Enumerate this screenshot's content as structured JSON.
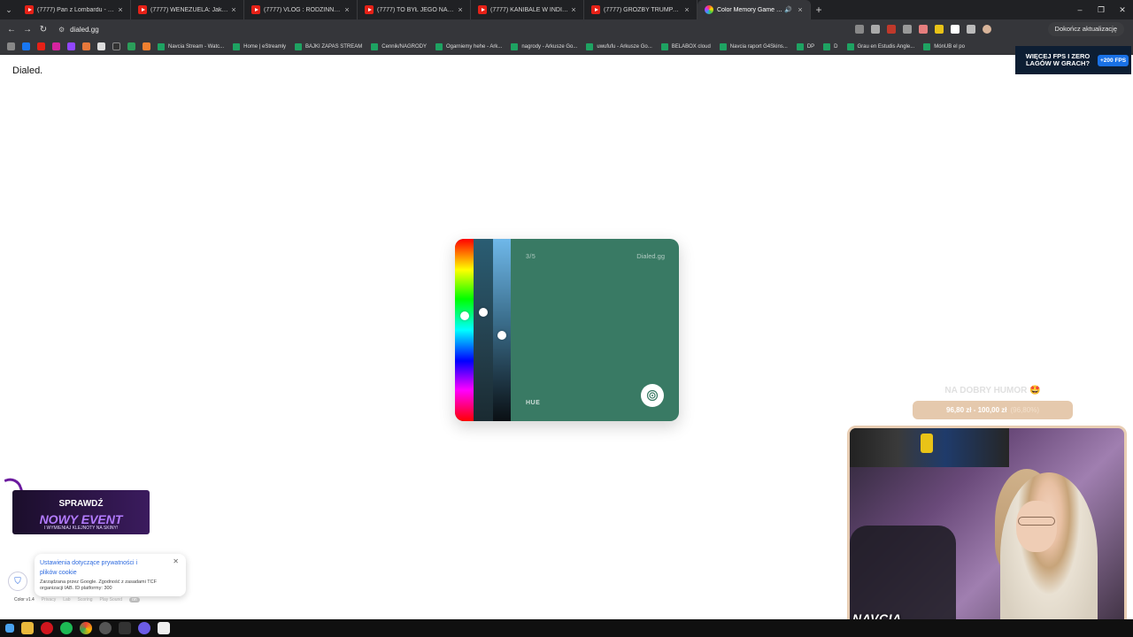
{
  "browser": {
    "tabs": [
      {
        "label": "(7777) Pan z Lombardu - YouTube",
        "type": "youtube"
      },
      {
        "label": "(7777) WENEZUELA: Jak bardzo je",
        "type": "youtube"
      },
      {
        "label": "(7777) VLOG : RODZINNY DZIEŃ",
        "type": "youtube"
      },
      {
        "label": "(7777) TO BYŁ JEGO NAJGORSZY",
        "type": "youtube"
      },
      {
        "label": "(7777) KANIBALE W INDIACH - D",
        "type": "youtube"
      },
      {
        "label": "(7777) GROŹBY TRUMPA WSTRZĄ",
        "type": "youtube"
      },
      {
        "label": "Color Memory Game — How",
        "type": "game",
        "active": true
      }
    ],
    "url": "dialed.gg",
    "update_button": "Dokończ aktualizację",
    "bookmarks": [
      "Navcia Stream - Watc...",
      "Home | eStreamly",
      "BAJKI ZAPAS STREAM",
      "Cennik/NAGRODY",
      "Ogarniemy hehe - Ark...",
      "nagrody - Arkusze Go...",
      "uwufufu - Arkusze Go...",
      "BELABOX cloud",
      "Navcia raport G4Skins...",
      "DP",
      "D",
      "Grau en Estudis Angle...",
      "MónUB el po"
    ]
  },
  "page": {
    "brand": "Dialed."
  },
  "game": {
    "counter": "3/5",
    "title": "Dialed.gg",
    "mode_label": "HUE",
    "color": "#397a64",
    "hue_level": 0.42,
    "saturation_level": 0.4,
    "brightness_level": 0.53
  },
  "overlays": {
    "fps_ad": {
      "text": "WIĘCEJ FPS I ZERO LAGÓW W GRACH?",
      "badge": "+200 FPS"
    },
    "stream_title": "NA DOBRY HUMOR 🤩",
    "donation": {
      "text": "96,80 zł - 100,00 zł",
      "percent": "(96,80%)"
    },
    "streamer_name": "NAVCIA",
    "event": {
      "line1": "SPRAWDŹ",
      "line2": "NOWY EVENT",
      "line3": "I WYMIENIAJ KLEJNOTY NA SKINY!"
    },
    "cookie": {
      "heading": "Ustawienia dotyczące prywatności i plików cookie",
      "sub": "Zarządzana przez Google. Zgodność z zasadami TCF organizacji IAB. ID platformy: 300"
    },
    "footer": {
      "version": "Color v1.4",
      "links": [
        "Privacy",
        "Lab",
        "Scoring",
        "Play Sound"
      ],
      "pill": "on"
    }
  }
}
